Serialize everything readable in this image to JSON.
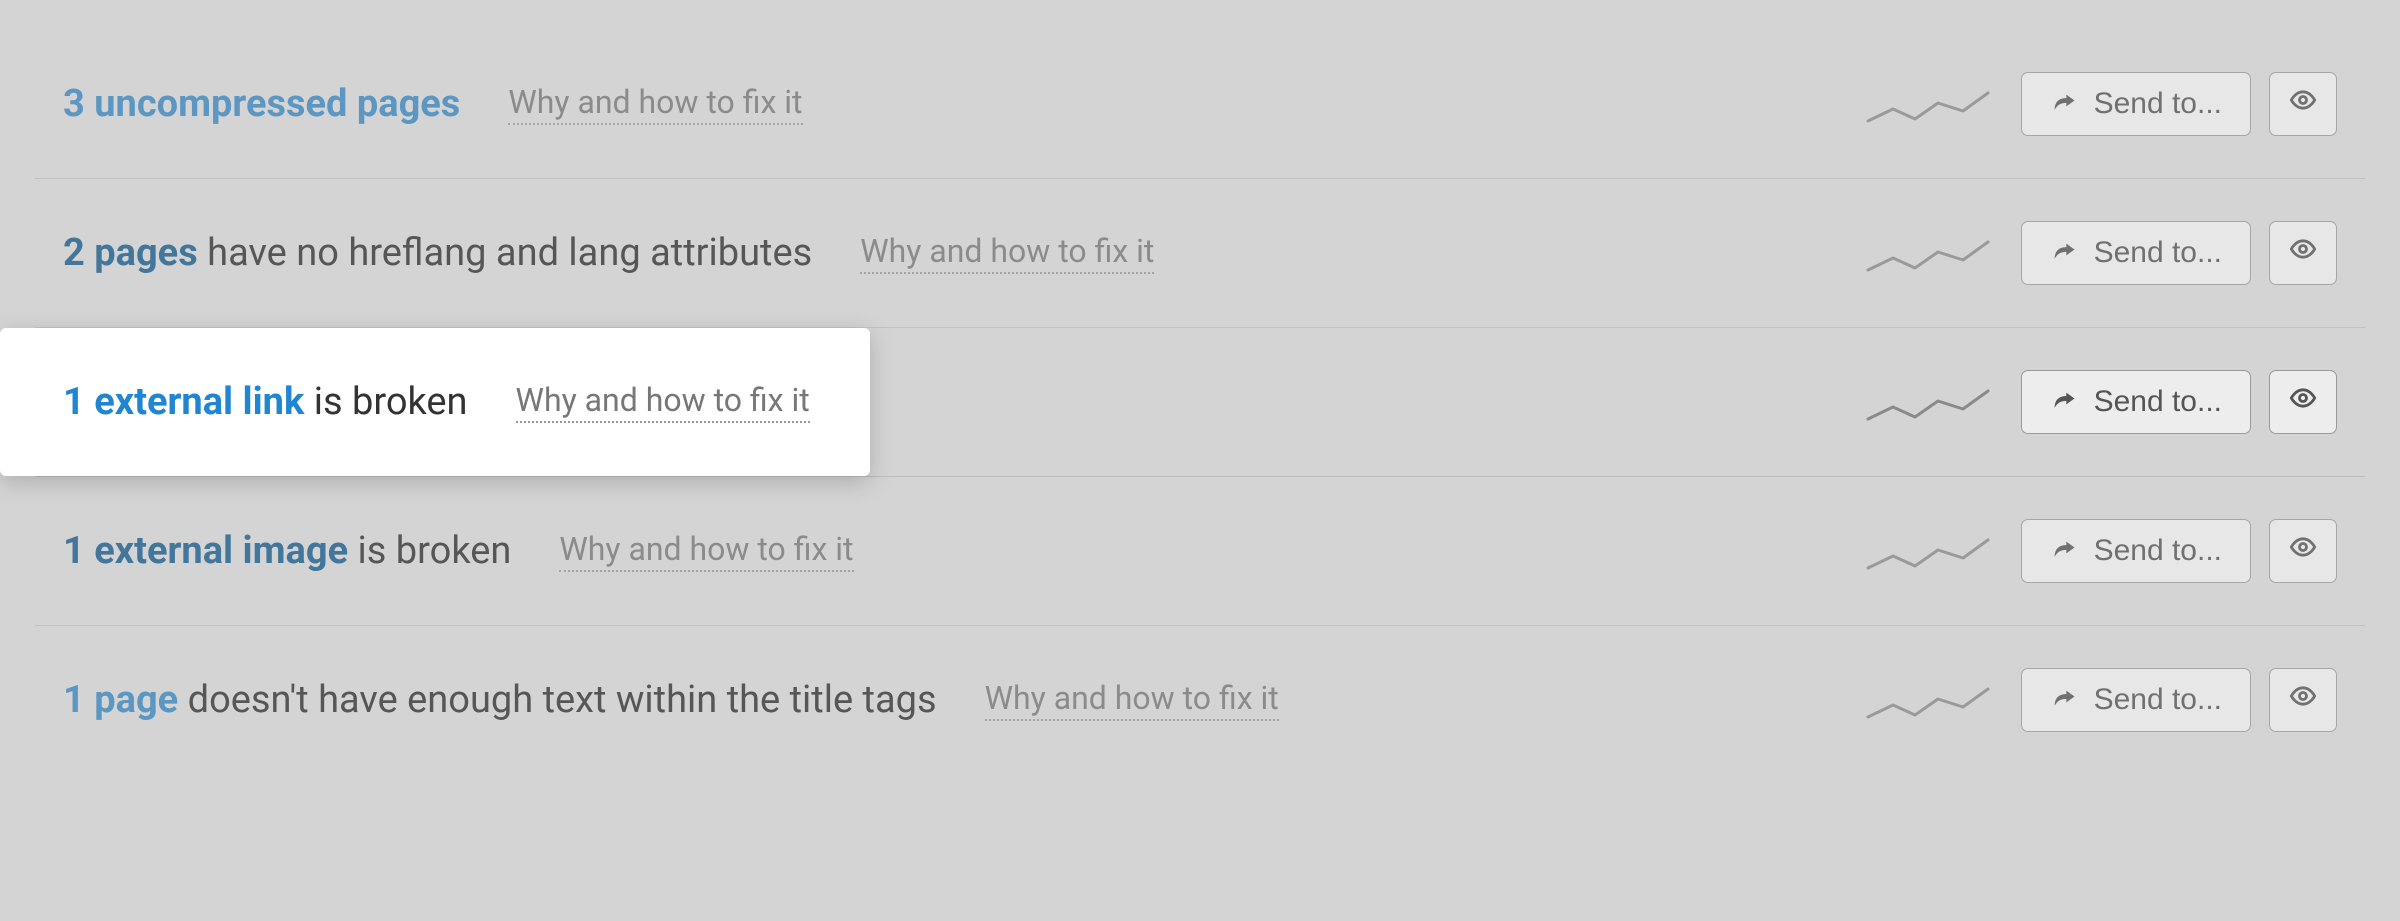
{
  "fix_link_label": "Why and how to fix it",
  "send_to_label": "Send to...",
  "issues": [
    {
      "count": 3,
      "label": "uncompressed pages",
      "suffix": "",
      "accent": "accent-blue",
      "highlighted": false
    },
    {
      "count": 2,
      "label": "pages",
      "suffix": "have no hreflang and lang attributes",
      "accent": "accent-dark",
      "highlighted": false
    },
    {
      "count": 1,
      "label": "external link",
      "suffix": "is broken",
      "accent": "accent-bright",
      "highlighted": true
    },
    {
      "count": 1,
      "label": "external image",
      "suffix": "is broken",
      "accent": "accent-dark",
      "highlighted": false
    },
    {
      "count": 1,
      "label": "page",
      "suffix": "doesn't have enough text within the title tags",
      "accent": "accent-blue",
      "highlighted": false
    }
  ]
}
